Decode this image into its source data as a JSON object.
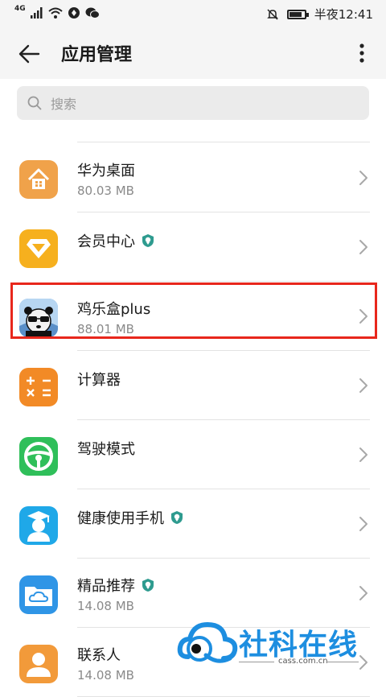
{
  "status_bar": {
    "network": "4G",
    "time": "半夜12:41",
    "battery_level": 0.85
  },
  "header": {
    "title": "应用管理"
  },
  "search": {
    "placeholder": "搜索",
    "value": ""
  },
  "apps": [
    {
      "name": "华为桌面",
      "size": "80.03 MB",
      "icon": "home-icon",
      "color": "#f0a24a",
      "shield": false,
      "highlighted": false
    },
    {
      "name": "会员中心",
      "size": "",
      "icon": "diamond-icon",
      "color": "#f6b01e",
      "shield": true,
      "highlighted": false
    },
    {
      "name": "鸡乐盒plus",
      "size": "88.01 MB",
      "icon": "panda-icon",
      "color": "#6aa6e8",
      "shield": false,
      "highlighted": true
    },
    {
      "name": "计算器",
      "size": "",
      "icon": "calculator-icon",
      "color": "#f28a26",
      "shield": false,
      "highlighted": false
    },
    {
      "name": "驾驶模式",
      "size": "",
      "icon": "steering-wheel-icon",
      "color": "#2fbf5a",
      "shield": false,
      "highlighted": false
    },
    {
      "name": "健康使用手机",
      "size": "",
      "icon": "graduate-icon",
      "color": "#1fa8e8",
      "shield": true,
      "highlighted": false
    },
    {
      "name": "精品推荐",
      "size": "14.08 MB",
      "icon": "cloud-folder-icon",
      "color": "#2f95e6",
      "shield": true,
      "highlighted": false
    },
    {
      "name": "联系人",
      "size": "14.08 MB",
      "icon": "contact-icon",
      "color": "#f29a3a",
      "shield": false,
      "highlighted": false
    }
  ],
  "watermark": {
    "text": "社科在线",
    "url": "cass.com.cn"
  },
  "colors": {
    "highlight": "#e8271c",
    "shield": "#2e9b8f"
  }
}
